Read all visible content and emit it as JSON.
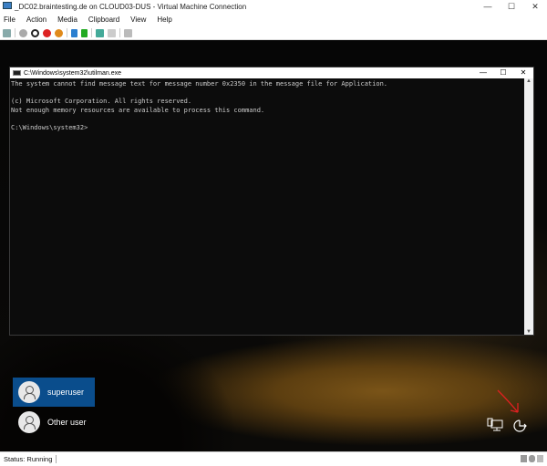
{
  "window": {
    "title": "_DC02.braintesting.de on CLOUD03-DUS - Virtual Machine Connection",
    "minimize": "—",
    "maximize": "☐",
    "close": "✕"
  },
  "menu": [
    "File",
    "Action",
    "Media",
    "Clipboard",
    "View",
    "Help"
  ],
  "console": {
    "title": "C:\\Windows\\system32\\utilman.exe",
    "minimize": "—",
    "maximize": "☐",
    "close": "✕",
    "output": "The system cannot find message text for message number 0x2350 in the message file for Application.\n\n(c) Microsoft Corporation. All rights reserved.\nNot enough memory resources are available to process this command.\n\nC:\\Windows\\system32>"
  },
  "login": {
    "users": [
      "superuser",
      "Other user"
    ]
  },
  "status": {
    "text": "Status: Running"
  },
  "colors": {
    "selected_user": "#0a4d8c",
    "annotation_arrow": "#e02020"
  }
}
